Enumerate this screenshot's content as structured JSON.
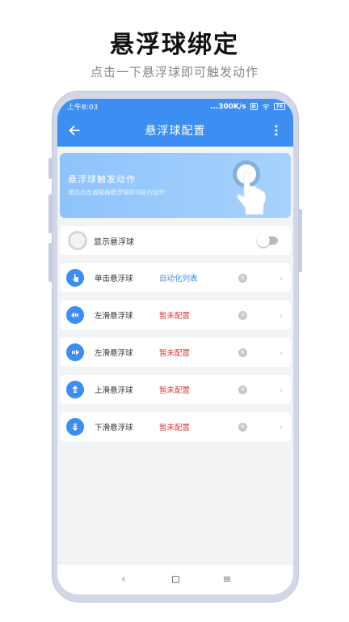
{
  "promo": {
    "title": "悬浮球绑定",
    "subtitle": "点击一下悬浮球即可触发动作"
  },
  "status_bar": {
    "time": "上午8:03",
    "network_speed": "...300K/s",
    "battery": "76"
  },
  "app_bar": {
    "title": "悬浮球配置",
    "back_icon": "arrow-left-icon",
    "more_icon": "more-vertical-icon"
  },
  "banner": {
    "title": "悬浮球触发动作",
    "description": "通过点击或拖拽悬浮球即可执行动作"
  },
  "floating_ball_toggle": {
    "label": "显示悬浮球",
    "enabled": false
  },
  "actions": [
    {
      "icon": "tap-icon",
      "label": "单击悬浮球",
      "value": "自动化列表",
      "value_color": "#3d8ef2"
    },
    {
      "icon": "swipe-left-icon",
      "label": "左滑悬浮球",
      "value": "暂未配置",
      "value_color": "#e53935"
    },
    {
      "icon": "swipe-right-icon",
      "label": "左滑悬浮球",
      "value": "暂未配置",
      "value_color": "#e53935"
    },
    {
      "icon": "swipe-up-icon",
      "label": "上滑悬浮球",
      "value": "暂未配置",
      "value_color": "#e53935"
    },
    {
      "icon": "swipe-down-icon",
      "label": "下滑悬浮球",
      "value": "暂未配置",
      "value_color": "#e53935"
    }
  ],
  "colors": {
    "primary": "#3d8ef2",
    "warning": "#e53935",
    "link": "#3d8ef2"
  }
}
